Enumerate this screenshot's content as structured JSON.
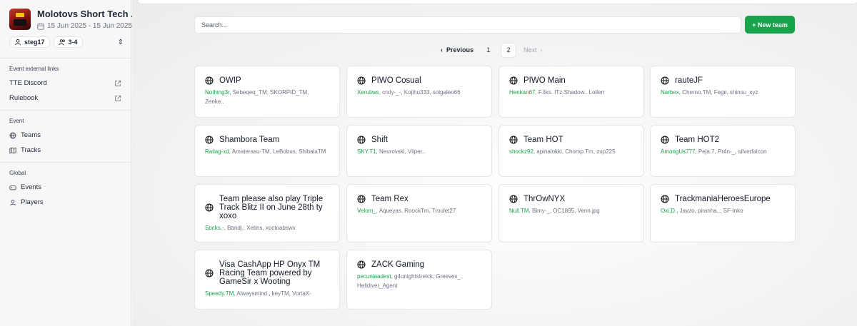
{
  "event": {
    "title": "Molotovs Short Tech ...",
    "dates": "15 Jun 2025 - 15 Jun 2025",
    "user_pill": "steg17",
    "group_pill": "3-4"
  },
  "sidebar": {
    "external_links_title": "Event external links",
    "external_links": [
      {
        "label": "TTE Discord"
      },
      {
        "label": "Rulebook"
      }
    ],
    "event_title": "Event",
    "event_items": [
      {
        "label": "Teams"
      },
      {
        "label": "Tracks"
      }
    ],
    "global_title": "Global",
    "global_items": [
      {
        "label": "Events"
      },
      {
        "label": "Players"
      }
    ]
  },
  "toolbar": {
    "search_placeholder": "Search...",
    "new_team_label": "+ New team"
  },
  "pagination": {
    "prev_label": "Previous",
    "pages": [
      "1",
      "2"
    ],
    "current": "2",
    "next_label": "Next"
  },
  "teams": [
    {
      "name": "OWIP",
      "lead": "Nothing3r",
      "members": ", Sebeqeq_TM, SKORPID_TM, Zenke.."
    },
    {
      "name": "PIWO Cosual",
      "lead": "Xerutiws",
      "members": ", crxly-_-, Kojihu333, solgaleo66"
    },
    {
      "name": "PIWO Main",
      "lead": "Henkan67",
      "members": ", F.liks. ITz.Shadow.. Lollerr"
    },
    {
      "name": "rauteJF",
      "lead": "Narbex",
      "members": ", Cherno.TM, Fegir, shinsu_xyz"
    },
    {
      "name": "Shambora Team",
      "lead": "Railag-xd",
      "members": ", Amaterasu-TM, LeBobus, ShibalaTM"
    },
    {
      "name": "Shift",
      "lead": "SKY.T1",
      "members": ", Neurovski, Viiper.."
    },
    {
      "name": "Team HOT",
      "lead": "shockz92",
      "members": ", apinalokki, Chomp.Tm, zup225"
    },
    {
      "name": "Team HOT2",
      "lead": "AmongUs777",
      "members": ", Peja.7, Pr4n-_, silverfalcon"
    },
    {
      "name": "Team please also play Triple Track Blitz II on June 28th ty xoxo",
      "lead": "Socks.-",
      "members": ", Bandj., Xetins, xoctoabswx"
    },
    {
      "name": "Team Rex",
      "lead": "Velom_",
      "members": ", Aqueyas, RoockTm, Troulet27"
    },
    {
      "name": "ThrOwNYX",
      "lead": "Null.TM",
      "members": ", Bimy-_, OC1895, Venn.jpg"
    },
    {
      "name": "TrackmaniaHeroesEurope",
      "lead": "Oxi.D.",
      "members": ", Javzo, piranha.., SF-Inko"
    },
    {
      "name": "Visa CashApp HP Onyx TM Racing Team powered by GameSir x Wooting",
      "lead": "Speedy.TM",
      "members": ", Alwaysmind., keyTM, VortaX-"
    },
    {
      "name": "ZACK Gaming",
      "lead": "pecuniaadest",
      "members": ", g4unightstreick, Greevex_, Helldiver_Agent"
    }
  ]
}
